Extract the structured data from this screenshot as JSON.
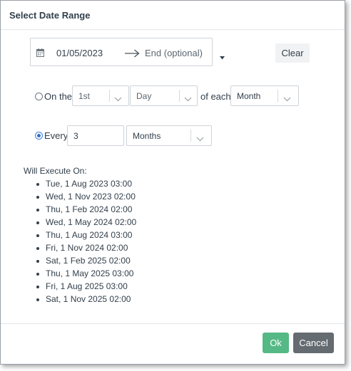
{
  "dialog": {
    "title": "Select Date Range"
  },
  "range": {
    "start": "01/05/2023",
    "end_placeholder": "End (optional)",
    "clear_label": "Clear"
  },
  "on_the": {
    "label": "On the",
    "ordinal": "1st",
    "unit": "Day",
    "of_each_label": "of each",
    "period": "Month",
    "selected": false
  },
  "every": {
    "label": "Every",
    "value": "3",
    "unit": "Months",
    "selected": true
  },
  "execution": {
    "title": "Will Execute On:",
    "dates": [
      "Tue, 1 Aug 2023 03:00",
      "Wed, 1 Nov 2023 02:00",
      "Thu, 1 Feb 2024 02:00",
      "Wed, 1 May 2024 02:00",
      "Thu, 1 Aug 2024 03:00",
      "Fri, 1 Nov 2024 02:00",
      "Sat, 1 Feb 2025 02:00",
      "Thu, 1 May 2025 03:00",
      "Fri, 1 Aug 2025 03:00",
      "Sat, 1 Nov 2025 02:00"
    ]
  },
  "footer": {
    "ok_label": "Ok",
    "cancel_label": "Cancel"
  },
  "colors": {
    "ok": "#55b985",
    "cancel": "#646b71",
    "radio_accent": "#2f6fce"
  },
  "icons": {
    "calendar": "calendar-icon",
    "arrow": "arrow-right-icon",
    "caret": "caret-down-icon",
    "chevron": "chevron-down-icon"
  }
}
